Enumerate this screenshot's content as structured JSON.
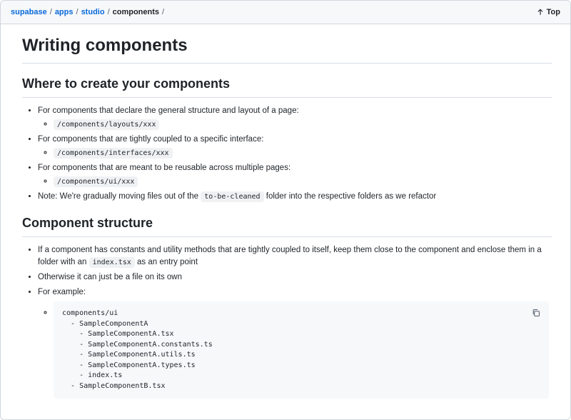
{
  "breadcrumb": {
    "items": [
      "supabase",
      "apps",
      "studio"
    ],
    "separator": "/",
    "current": "components",
    "trailing_sep": "/"
  },
  "top_link": {
    "label": "Top"
  },
  "title": "Writing components",
  "section1": {
    "heading": "Where to create your components",
    "items": [
      {
        "text": "For components that declare the general structure and layout of a page:",
        "sub": "/components/layouts/xxx"
      },
      {
        "text": "For components that are tightly coupled to a specific interface:",
        "sub": "/components/interfaces/xxx"
      },
      {
        "text": "For components that are meant to be reusable across multiple pages:",
        "sub": "/components/ui/xxx"
      }
    ],
    "note": {
      "before": "Note: We're gradually moving files out of the",
      "code": "to-be-cleaned",
      "after": "folder into the respective folders as we refactor"
    }
  },
  "section2": {
    "heading": "Component structure",
    "item1": {
      "before": "If a component has constants and utility methods that are tightly coupled to itself, keep them close to the component and enclose them in a folder with an",
      "code": "index.tsx",
      "after": "as an entry point"
    },
    "item2": "Otherwise it can just be a file on its own",
    "item3": "For example:",
    "code_lines": [
      "components/ui",
      "  - SampleComponentA",
      "    - SampleComponentA.tsx",
      "    - SampleComponentA.constants.ts",
      "    - SampleComponentA.utils.ts",
      "    - SampleComponentA.types.ts",
      "    - index.ts",
      "  - SampleComponentB.tsx"
    ]
  },
  "icons": {
    "top": "arrow-up-icon",
    "copy": "copy-icon"
  },
  "colors": {
    "link": "#0969da",
    "code_bg": "#f6f8fa"
  }
}
